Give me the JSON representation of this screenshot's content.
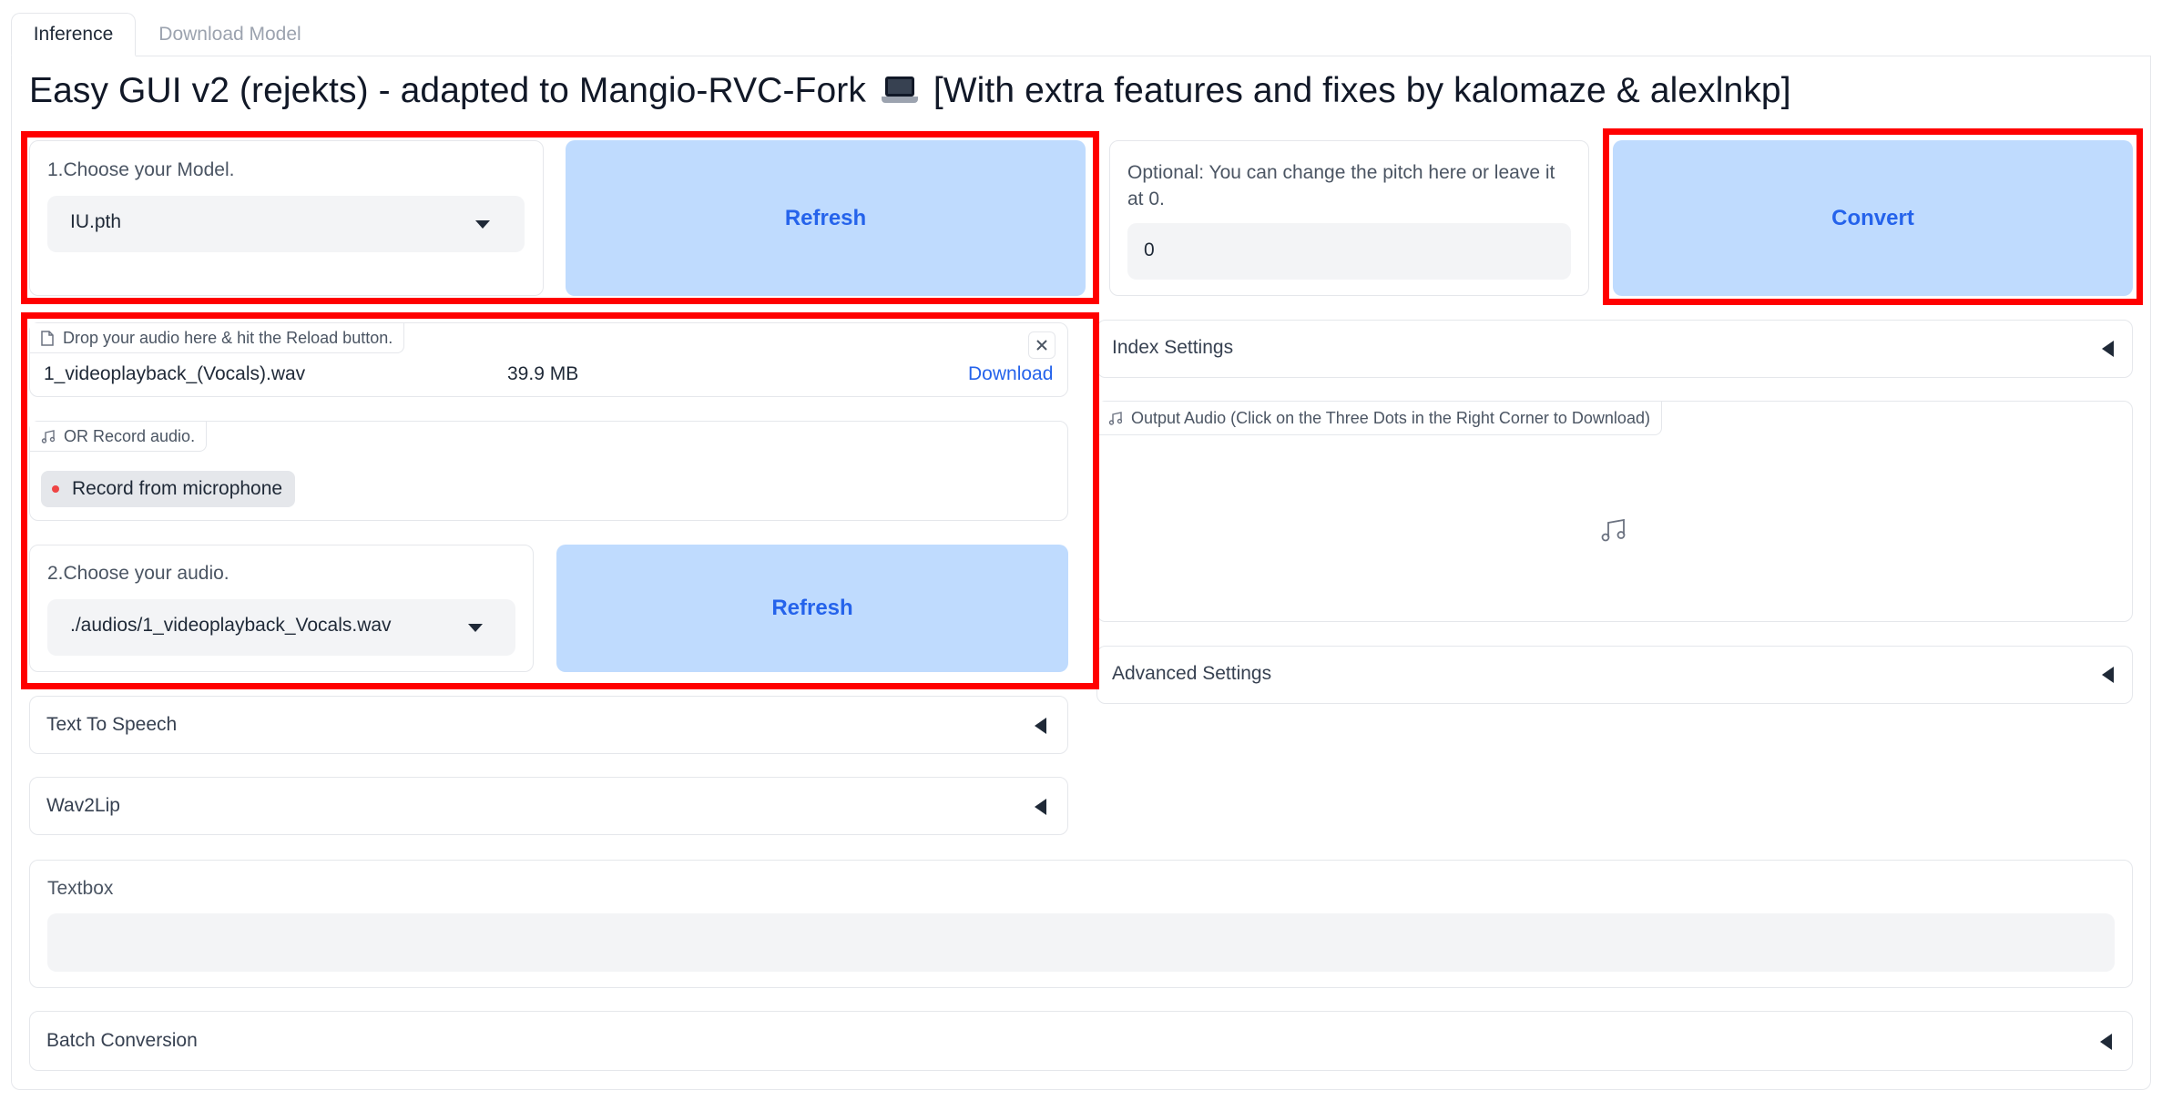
{
  "tabs": [
    {
      "label": "Inference",
      "active": true
    },
    {
      "label": "Download Model",
      "active": false
    }
  ],
  "title": "Easy GUI v2 (rejekts) - adapted to Mangio-RVC-Fork",
  "title_suffix": "[With extra features and fixes by kalomaze & alexlnkp]",
  "model": {
    "label": "1.Choose your Model.",
    "selected": "IU.pth",
    "refresh_label": "Refresh"
  },
  "pitch": {
    "label": "Optional: You can change the pitch here or leave it at 0.",
    "value": "0"
  },
  "convert_label": "Convert",
  "upload": {
    "chip": "Drop your audio here & hit the Reload button.",
    "file_name": "1_videoplayback_(Vocals).wav",
    "file_size": "39.9 MB",
    "download_label": "Download"
  },
  "record": {
    "chip": "OR Record audio.",
    "button_label": "Record from microphone"
  },
  "audio": {
    "label": "2.Choose your audio.",
    "selected": "./audios/1_videoplayback_Vocals.wav",
    "refresh_label": "Refresh"
  },
  "accordions": {
    "index_settings": "Index Settings",
    "advanced_settings": "Advanced Settings",
    "text_to_speech": "Text To Speech",
    "wav2lip": "Wav2Lip",
    "batch_conversion": "Batch Conversion"
  },
  "output_audio": {
    "chip": "Output Audio (Click on the Three Dots in the Right Corner to Download)"
  },
  "textbox": {
    "label": "Textbox",
    "value": ""
  },
  "colors": {
    "button_bg": "#bfdbfe",
    "button_text": "#2563eb",
    "highlight": "#ff0000",
    "record_dot": "#ef4444"
  }
}
